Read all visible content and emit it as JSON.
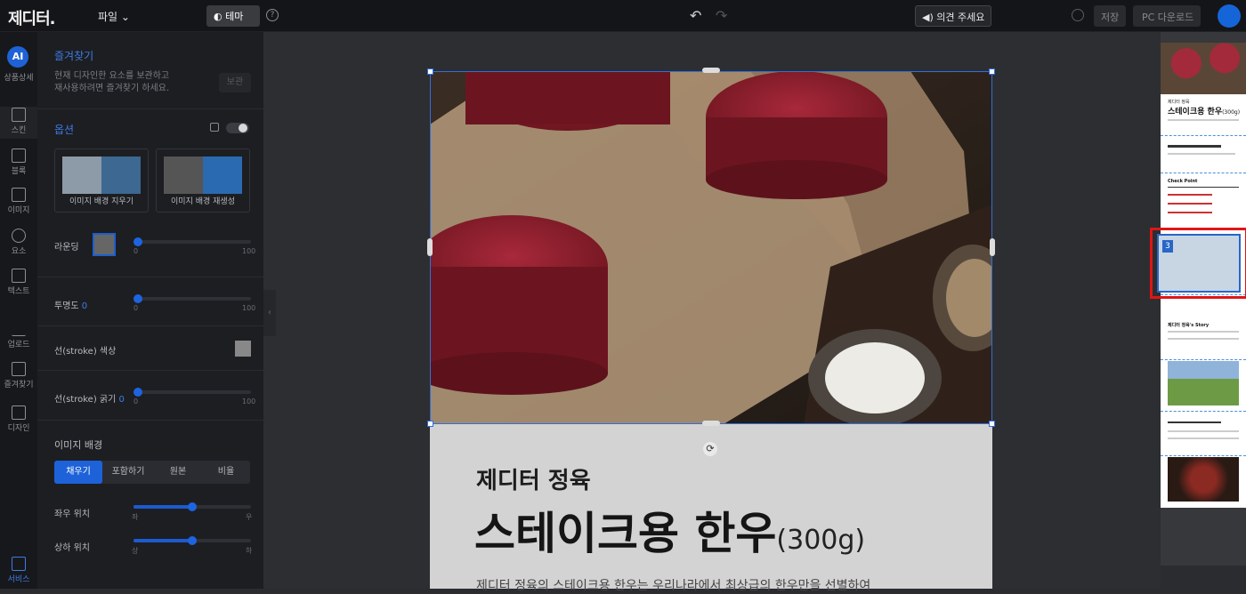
{
  "topbar": {
    "logo": "제디터.",
    "file_menu": "파일",
    "theme_button": "테마",
    "feedback_button": "의견 주세요",
    "save_button": "저장",
    "pc_download_button": "PC 다운로드"
  },
  "left_nav": {
    "ai_badge": "AI",
    "items": [
      {
        "label": "상품상세",
        "icon": "ai-icon"
      },
      {
        "label": "스킨",
        "icon": "skin-icon"
      },
      {
        "label": "블록",
        "icon": "block-icon"
      },
      {
        "label": "이미지",
        "icon": "image-icon"
      },
      {
        "label": "요소",
        "icon": "element-icon"
      },
      {
        "label": "텍스트",
        "icon": "text-icon"
      },
      {
        "label": "업로드",
        "icon": "upload-icon"
      },
      {
        "label": "즐겨찾기",
        "icon": "bookmark-icon"
      },
      {
        "label": "디자인",
        "icon": "my-design-icon"
      },
      {
        "label": "서비스",
        "icon": "service-icon"
      }
    ]
  },
  "panel": {
    "favorites_title": "즐겨찾기",
    "favorites_desc_1": "현재 디자인한 요소를 보관하고",
    "favorites_desc_2": "재사용하려면 즐겨찾기 하세요.",
    "favorites_save": "보관",
    "options_title": "옵션",
    "remove_bg": "이미지 배경 지우기",
    "regen_bg": "이미지 배경 재생성",
    "rounding_label": "라운딩",
    "opacity_label": "투명도",
    "opacity_value": "0",
    "stroke_color_label": "선(stroke) 색상",
    "stroke_width_label": "선(stroke) 굵기",
    "stroke_width_value": "0",
    "tick_min": "0",
    "tick_max": "100",
    "image_bg_title": "이미지 배경",
    "fit_options": [
      "채우기",
      "포함하기",
      "원본",
      "비율"
    ],
    "h_position_label": "좌우 위치",
    "h_left": "좌",
    "h_right": "우",
    "v_position_label": "상하 위치",
    "v_top": "상",
    "v_bottom": "하",
    "sliders": {
      "rounding": 0,
      "opacity": 0,
      "stroke_width": 0,
      "h_position": 0.5,
      "v_position": 0.5
    }
  },
  "page": {
    "brand": "제디터 정육",
    "title": "스테이크용 한우",
    "title_suffix": "(300g)",
    "desc": "제디터 정육의 스테이크용 한우는 우리나라에서 최상급의 한우만을 선별하여"
  },
  "sidebar": {
    "selected_page": "3",
    "mini_brand": "제디터 정육",
    "mini_title": "스테이크용 한우",
    "mini_title_suffix": "(300g)",
    "mini_check": "Check Point",
    "mini_story": "제디터 정육's Story"
  },
  "colors": {
    "accent": "#1d62d8",
    "selection": "#2f6fe0",
    "highlight": "#e01515"
  }
}
